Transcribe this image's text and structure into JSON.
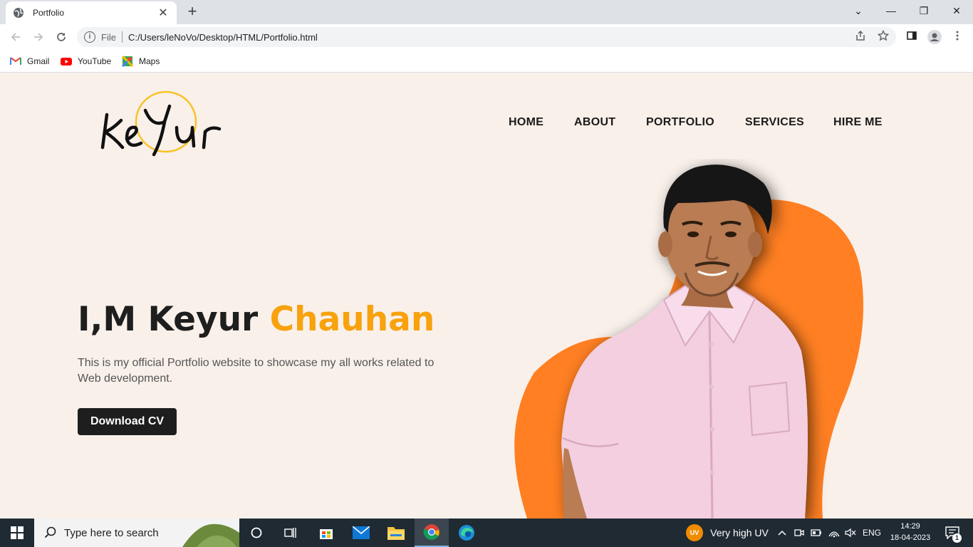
{
  "browser": {
    "tab_title": "Portfolio",
    "tab_close": "✕",
    "new_tab": "+",
    "omnibox_scheme": "File",
    "url": "C:/Users/leNoVo/Desktop/HTML/Portfolio.html",
    "window_controls": {
      "chevron": "⌄",
      "minimize": "—",
      "restore": "❐",
      "close": "✕"
    }
  },
  "bookmarks": [
    {
      "label": "Gmail",
      "icon": "gmail-icon"
    },
    {
      "label": "YouTube",
      "icon": "youtube-icon"
    },
    {
      "label": "Maps",
      "icon": "maps-icon"
    }
  ],
  "site": {
    "nav": [
      "HOME",
      "ABOUT",
      "PORTFOLIO",
      "SERVICES",
      "HIRE ME"
    ],
    "hero": {
      "prefix": "I,M Keyur ",
      "accent": "Chauhan",
      "description": "This is my official Portfolio website to showcase my all works related to Web development.",
      "cta": "Download CV"
    },
    "colors": {
      "accent": "#f8a20e",
      "blob": "#ff7f22",
      "background": "#f9f0ea",
      "button": "#1e1e1e"
    }
  },
  "taskbar": {
    "search_placeholder": "Type here to search",
    "uv_badge": "UV",
    "uv_text": "Very high UV",
    "language": "ENG",
    "time": "14:29",
    "date": "18-04-2023",
    "notification_count": "1"
  }
}
